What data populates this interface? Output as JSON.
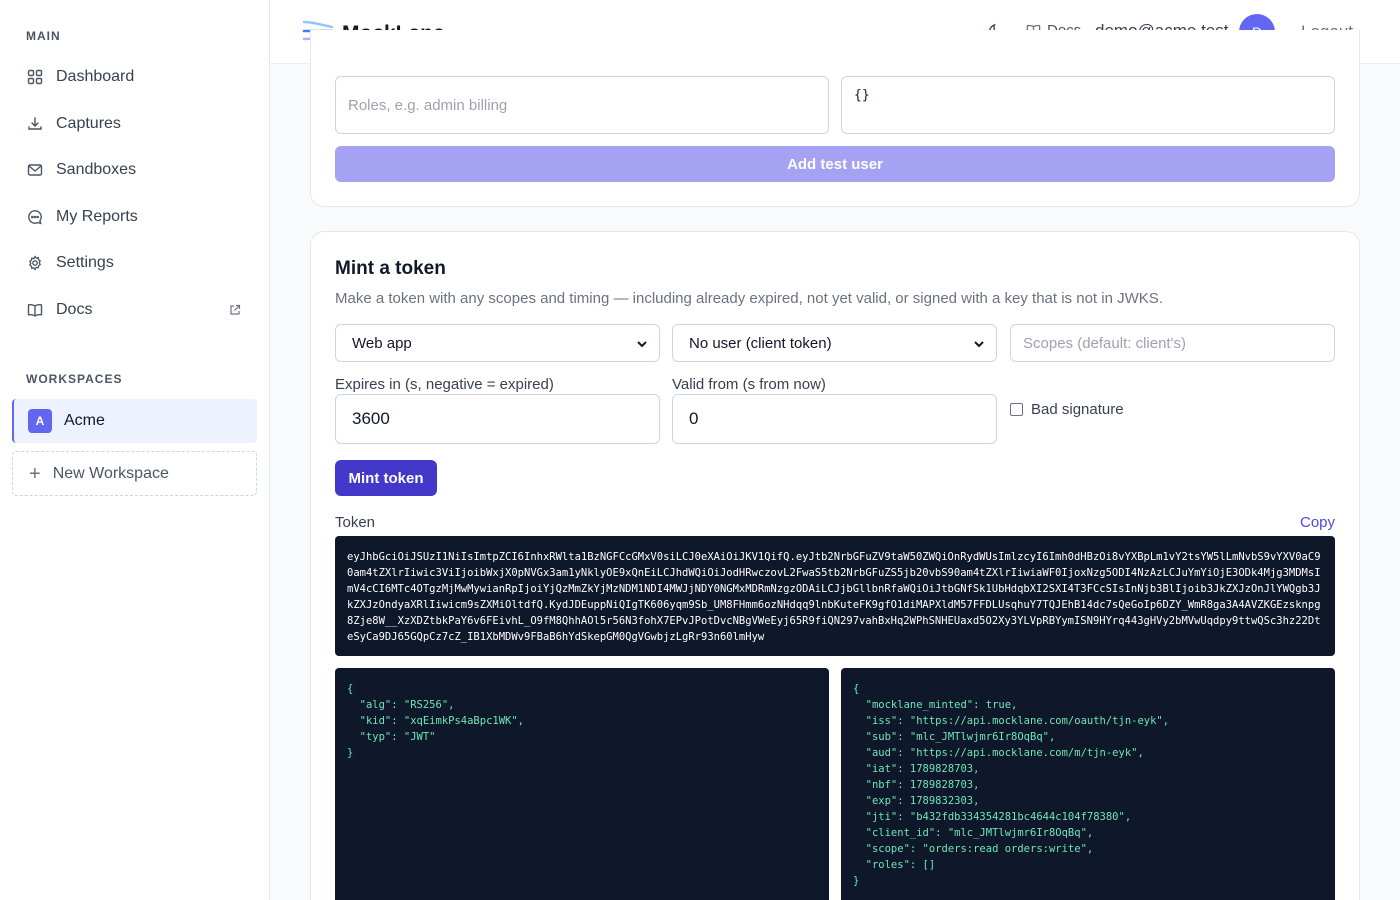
{
  "sidebar": {
    "main_label": "MAIN",
    "items": [
      {
        "label": "Dashboard",
        "icon": "grid-icon"
      },
      {
        "label": "Captures",
        "icon": "download-tray-icon"
      },
      {
        "label": "Sandboxes",
        "icon": "envelope-icon"
      },
      {
        "label": "My Reports",
        "icon": "chat-bubble-icon"
      },
      {
        "label": "Settings",
        "icon": "gear-icon"
      },
      {
        "label": "Docs",
        "icon": "book-icon"
      }
    ],
    "workspaces_label": "WORKSPACES",
    "workspace": {
      "initial": "A",
      "name": "Acme"
    },
    "new_workspace": "New Workspace"
  },
  "header": {
    "app_name": "MockLane",
    "docs": "Docs",
    "email": "demo@acme.test",
    "avatar_initial": "D",
    "logout": "Logout"
  },
  "test_user_form": {
    "roles_placeholder": "Roles, e.g. admin billing",
    "claims_value": "{}",
    "add_button": "Add test user"
  },
  "mint": {
    "title": "Mint a token",
    "subtitle": "Make a token with any scopes and timing — including already expired, not yet valid, or signed with a key that is not in JWKS.",
    "client_select": "Web app",
    "user_select": "No user (client token)",
    "scopes_placeholder": "Scopes (default: client's)",
    "expires_label": "Expires in (s, negative = expired)",
    "expires_value": "3600",
    "valid_from_label": "Valid from (s from now)",
    "valid_from_value": "0",
    "bad_signature_label": "Bad signature",
    "mint_button": "Mint token",
    "token_label": "Token",
    "copy": "Copy",
    "token": "eyJhbGciOiJSUzI1NiIsImtpZCI6InhxRWlta1BzNGFCcGMxV0siLCJ0eXAiOiJKV1QifQ.eyJtb2NrbGFuZV9taW50ZWQiOnRydWUsImlzcyI6Imh0dHBzOi8vYXBpLm1vY2tsYW5lLmNvbS9vYXV0aC90am4tZXlrIiwic3ViIjoibWxjX0pNVGx3am1yNklyOE9xQnEiLCJhdWQiOiJodHRwczovL2FwaS5tb2NrbGFuZS5jb20vbS90am4tZXlrIiwiaWF0IjoxNzg5ODI4NzAzLCJuYmYiOjE3ODk4Mjg3MDMsImV4cCI6MTc4OTgzMjMwMywianRpIjoiYjQzMmZkYjMzNDM1NDI4MWJjNDY0NGMxMDRmNzgzODAiLCJjbGllbnRfaWQiOiJtbGNfSk1UbHdqbXI2SXI4T3FCcSIsInNjb3BlIjoib3JkZXJzOnJlYWQgb3JkZXJzOndyaXRlIiwicm9sZXMiOltdfQ.KydJDEuppNiQIgTK606yqm9Sb_UM8FHmm6ozNHdqq9lnbKuteFK9gfO1diMAPXldM57FFDLUsqhuY7TQJEhB14dc7sQeGoIp6DZY_WmR8ga3A4AVZKGEzsknpg8Zje8W__XzXDZtbkPaY6v6FEivhL_O9fM8QhhAOl5r56N3fohX7EPvJPotDvcNBgVWeEyj65R9fiQN297vahBxHq2WPhSNHEUaxd5O2Xy3YLVpRBYymISN9HYrq443gHVy2bMVwUqdpy9ttwQSc3hz22DteSyCa9DJ65GQpCz7cZ_IB1XbMDWv9FBaB6hYdSkepGM0QgVGwbjzLgRr93n60lmHyw",
    "header_json": "{\n  \"alg\": \"RS256\",\n  \"kid\": \"xqEimkPs4aBpc1WK\",\n  \"typ\": \"JWT\"\n}",
    "payload_json": "{\n  \"mocklane_minted\": true,\n  \"iss\": \"https://api.mocklane.com/oauth/tjn-eyk\",\n  \"sub\": \"mlc_JMTlwjmr6Ir8OqBq\",\n  \"aud\": \"https://api.mocklane.com/m/tjn-eyk\",\n  \"iat\": 1789828703,\n  \"nbf\": 1789828703,\n  \"exp\": 1789832303,\n  \"jti\": \"b432fdb334354281bc4644c104f78380\",\n  \"client_id\": \"mlc_JMTlwjmr6Ir8OqBq\",\n  \"scope\": \"orders:read orders:write\",\n  \"roles\": []\n}"
  },
  "colors": {
    "accent": "#4338ca",
    "accent_light": "#a5a1f3",
    "avatar": "#6366f1",
    "code_bg": "#0f172a",
    "code_green": "#6ee7b7"
  }
}
